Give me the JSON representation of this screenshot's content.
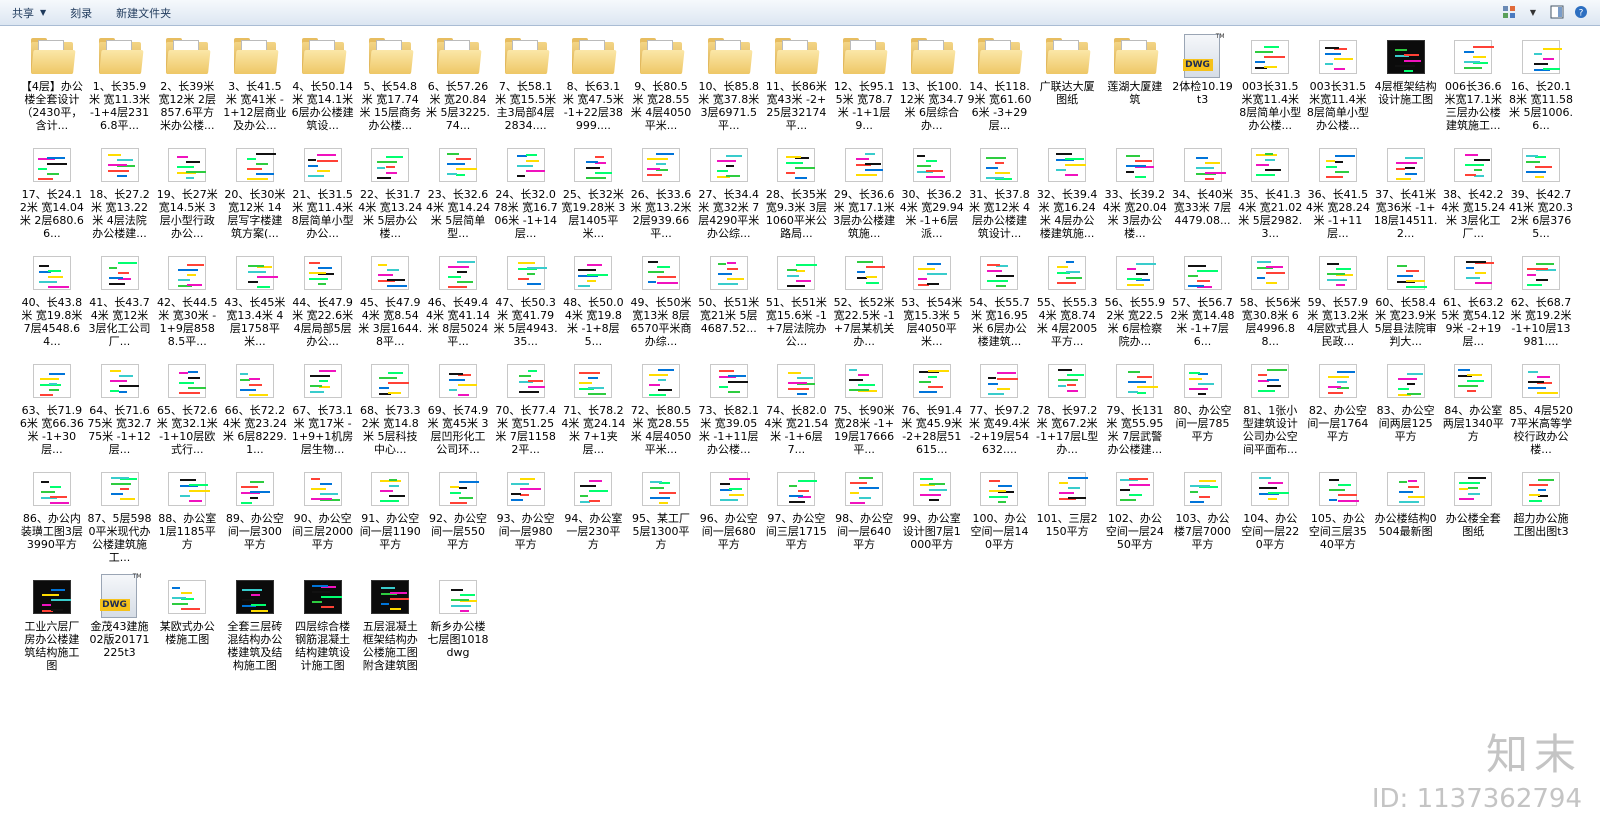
{
  "toolbar": {
    "share": "共享",
    "burn": "刻录",
    "new_folder": "新建文件夹"
  },
  "items": [
    {
      "label": "【4层】办公楼全套设计（2430平，含计...",
      "kind": "folder"
    },
    {
      "label": "1、长35.9米 宽11.3米 -1+4层2316.8平...",
      "kind": "folder"
    },
    {
      "label": "2、长39米 宽12米 2层857.6平方米办公楼...",
      "kind": "folder"
    },
    {
      "label": "3、长41.5米 宽41米 -1+12层商业及办公...",
      "kind": "folder"
    },
    {
      "label": "4、长50.14米 宽14.1米 6层办公楼建筑设...",
      "kind": "folder"
    },
    {
      "label": "5、长54.8米 宽17.74米 15层商务办公楼...",
      "kind": "folder"
    },
    {
      "label": "6、长57.26米 宽20.84米 5层3225.74...",
      "kind": "folder"
    },
    {
      "label": "7、长58.1米 宽15.5米 主3局部4层2834....",
      "kind": "folder"
    },
    {
      "label": "8、长63.1米 宽47.5米 -1+22层38999....",
      "kind": "folder"
    },
    {
      "label": "9、长80.5米 宽28.55米 4层4050平米...",
      "kind": "folder"
    },
    {
      "label": "10、长85.8米 宽37.8米 3层6971.5平...",
      "kind": "folder"
    },
    {
      "label": "11、长86米 宽43米 -2+25层32174平...",
      "kind": "folder"
    },
    {
      "label": "12、长95.15米 宽78.7米 -1+1层9...",
      "kind": "folder"
    },
    {
      "label": "13、长100.12米 宽34.7米 6层综合办...",
      "kind": "folder"
    },
    {
      "label": "14、长118.9米 宽61.606米 -3+29层...",
      "kind": "folder"
    },
    {
      "label": "广联达大厦图纸",
      "kind": "folder"
    },
    {
      "label": "莲湖大厦建筑",
      "kind": "folder"
    },
    {
      "label": "2体检10.19t3",
      "kind": "dwg"
    },
    {
      "label": "003长31.5米宽11.4米 8层简单小型办公楼...",
      "kind": "cad"
    },
    {
      "label": "003长31.5米宽11.4米 8层简单小型办公楼...",
      "kind": "cad"
    },
    {
      "label": "4层框架结构设计施工图",
      "kind": "cad-dark"
    },
    {
      "label": "006长36.6米宽17.1米 三层办公楼建筑施工...",
      "kind": "cad"
    },
    {
      "label": "16、长20.18米 宽11.58米 5层1006.6...",
      "kind": "cad"
    },
    {
      "label": "17、长24.12米 宽14.04米 2层680.66...",
      "kind": "cad"
    },
    {
      "label": "18、长27.2米 宽13.22米 4层法院办公楼建...",
      "kind": "cad"
    },
    {
      "label": "19、长27米 宽14.5米 3层小型行政办公...",
      "kind": "cad"
    },
    {
      "label": "20、长30米 宽12米 14层写字楼建筑方案(...",
      "kind": "cad"
    },
    {
      "label": "21、长31.5米 宽11.4米 8层简单小型办公...",
      "kind": "cad"
    },
    {
      "label": "22、长31.74米 宽13.24米 5层办公楼...",
      "kind": "cad"
    },
    {
      "label": "23、长32.64米 宽14.24米 5层简单型...",
      "kind": "cad"
    },
    {
      "label": "24、长32.078米 宽16.706米 -1+14层...",
      "kind": "cad"
    },
    {
      "label": "25、长32米 宽19.28米 3层1405平米...",
      "kind": "cad"
    },
    {
      "label": "26、长33.6米 宽13.2米 2层939.66平...",
      "kind": "cad"
    },
    {
      "label": "27、长34.4米 宽32米 7层4290平米办公综...",
      "kind": "cad"
    },
    {
      "label": "28、长35米 宽9.3米 3层1060平米公路局...",
      "kind": "cad"
    },
    {
      "label": "29、长36.6米 宽17.1米 3层办公楼建筑施...",
      "kind": "cad"
    },
    {
      "label": "30、长36.24米 宽29.94米 -1+6层派...",
      "kind": "cad"
    },
    {
      "label": "31、长37.8米 宽12米 4层办公楼建筑设计...",
      "kind": "cad"
    },
    {
      "label": "32、长39.4米 宽16.24米 4层办公楼建筑施...",
      "kind": "cad"
    },
    {
      "label": "33、长39.24米 宽20.04米 3层办公楼...",
      "kind": "cad"
    },
    {
      "label": "34、长40米 宽33米 7层4479.08...",
      "kind": "cad"
    },
    {
      "label": "35、长41.34米 宽21.02米 5层2982.3...",
      "kind": "cad"
    },
    {
      "label": "36、长41.54米 宽28.24米 -1+11层...",
      "kind": "cad"
    },
    {
      "label": "37、长41米 宽36米 -1+18层14511.2...",
      "kind": "cad"
    },
    {
      "label": "38、长42.24米 宽15.24米 3层化工厂...",
      "kind": "cad"
    },
    {
      "label": "39、长42.741米 宽20.32米 6层3765...",
      "kind": "cad"
    },
    {
      "label": "40、长43.8米 宽19.8米 7层4548.64...",
      "kind": "cad"
    },
    {
      "label": "41、长43.74米 宽12米 3层化工公司厂...",
      "kind": "cad"
    },
    {
      "label": "42、长44.5米 宽30米 -1+9层8588.5平...",
      "kind": "cad"
    },
    {
      "label": "43、长45米 宽13.4米 4层1758平米...",
      "kind": "cad"
    },
    {
      "label": "44、长47.9米 宽22.6米 4层局部5层办公...",
      "kind": "cad"
    },
    {
      "label": "45、长47.94米 宽8.54米 3层1644.8平...",
      "kind": "cad"
    },
    {
      "label": "46、长49.44米 宽41.14米 8层5024平...",
      "kind": "cad"
    },
    {
      "label": "47、长50.3米 宽41.79米 5层4943.35...",
      "kind": "cad"
    },
    {
      "label": "48、长50.04米 宽19.8米 -1+8层5...",
      "kind": "cad"
    },
    {
      "label": "49、长50米 宽13米 8层6570平米商办综...",
      "kind": "cad"
    },
    {
      "label": "50、长51米 宽21米 5层4687.52...",
      "kind": "cad"
    },
    {
      "label": "51、长51米 宽15.6米 -1+7层法院办公...",
      "kind": "cad"
    },
    {
      "label": "52、长52米 宽22.5米 -1+7层某机关办...",
      "kind": "cad"
    },
    {
      "label": "53、长54米 宽15.3米 5层4050平米...",
      "kind": "cad"
    },
    {
      "label": "54、长55.7米 宽16.95米 6层办公楼建筑...",
      "kind": "cad"
    },
    {
      "label": "55、长55.34米 宽8.74米 4层2005平方...",
      "kind": "cad"
    },
    {
      "label": "56、长55.92米 宽22.5米 6层检察院办...",
      "kind": "cad"
    },
    {
      "label": "57、长56.72米 宽14.48米 -1+7层6...",
      "kind": "cad"
    },
    {
      "label": "58、长56米 宽30.8米 6层4996.88...",
      "kind": "cad"
    },
    {
      "label": "59、长57.9米 宽13.2米 4层欧式县人民政...",
      "kind": "cad"
    },
    {
      "label": "60、长58.4米 宽23.9米 5层县法院审判大...",
      "kind": "cad"
    },
    {
      "label": "61、长63.25米 宽54.129米 -2+19层...",
      "kind": "cad"
    },
    {
      "label": "62、长68.7米 宽19.2米 -1+10层13981....",
      "kind": "cad"
    },
    {
      "label": "63、长71.96米 宽66.36米 -1+30层...",
      "kind": "cad"
    },
    {
      "label": "64、长71.675米 宽32.775米 -1+12层...",
      "kind": "cad"
    },
    {
      "label": "65、长72.6米 宽32.1米 -1+10层欧式行...",
      "kind": "cad"
    },
    {
      "label": "66、长72.24米 宽23.24米 6层8229.1...",
      "kind": "cad"
    },
    {
      "label": "67、长73.1米 宽17米 -1+9+1机房层生物...",
      "kind": "cad"
    },
    {
      "label": "68、长73.32米 宽14.8米 5层科技中心...",
      "kind": "cad"
    },
    {
      "label": "69、长74.9米 宽45米 3层凹形化工公司环...",
      "kind": "cad"
    },
    {
      "label": "70、长77.4米 宽51.25米 7层11582平...",
      "kind": "cad"
    },
    {
      "label": "71、长78.24米 宽24.14米 7+1夹层...",
      "kind": "cad"
    },
    {
      "label": "72、长80.5米 宽28.55米 4层4050平米...",
      "kind": "cad"
    },
    {
      "label": "73、长82.1米 宽39.05米 -1+11层办公楼...",
      "kind": "cad"
    },
    {
      "label": "74、长82.04米 宽21.54米 -1+6层7...",
      "kind": "cad"
    },
    {
      "label": "75、长90米 宽28米 -1+19层17666平...",
      "kind": "cad"
    },
    {
      "label": "76、长91.4米 宽45.9米 -2+28层51615...",
      "kind": "cad"
    },
    {
      "label": "77、长97.2米 宽49.4米 -2+19层54632....",
      "kind": "cad"
    },
    {
      "label": "78、长97.2米 宽67.2米 -1+17层L型办...",
      "kind": "cad"
    },
    {
      "label": "79、长131米 宽55.95米 7层武警办公楼建...",
      "kind": "cad"
    },
    {
      "label": "80、办公空间一层785平方",
      "kind": "cad"
    },
    {
      "label": "81、1张小型建筑设计公司办公空间平面布...",
      "kind": "cad"
    },
    {
      "label": "82、办公空间一层1764平方",
      "kind": "cad"
    },
    {
      "label": "83、办公空间两层125平方",
      "kind": "cad"
    },
    {
      "label": "84、办公室两层1340平方",
      "kind": "cad"
    },
    {
      "label": "85、4层5207平米高等学校行政办公楼...",
      "kind": "cad"
    },
    {
      "label": "86、办公内装璜工图3层3990平方",
      "kind": "cad"
    },
    {
      "label": "87、5层5980平米现代办公楼建筑施工...",
      "kind": "cad"
    },
    {
      "label": "88、办公室1层1185平方",
      "kind": "cad"
    },
    {
      "label": "89、办公空间一层300平方",
      "kind": "cad"
    },
    {
      "label": "90、办公空间三层2000平方",
      "kind": "cad"
    },
    {
      "label": "91、办公空间一层1190平方",
      "kind": "cad"
    },
    {
      "label": "92、办公空间一层550平方",
      "kind": "cad"
    },
    {
      "label": "93、办公空间一层980平方",
      "kind": "cad"
    },
    {
      "label": "94、办公室一层230平方",
      "kind": "cad"
    },
    {
      "label": "95、某工厂5层1300平方",
      "kind": "cad"
    },
    {
      "label": "96、办公空间一层680平方",
      "kind": "cad"
    },
    {
      "label": "97、办公空间三层1715平方",
      "kind": "cad"
    },
    {
      "label": "98、办公空间一层640平方",
      "kind": "cad"
    },
    {
      "label": "99、办公室设计图7层1000平方",
      "kind": "cad"
    },
    {
      "label": "100、办公空间一层140平方",
      "kind": "cad"
    },
    {
      "label": "101、三层2150平方",
      "kind": "cad"
    },
    {
      "label": "102、办公空间一层2450平方",
      "kind": "cad"
    },
    {
      "label": "103、办公楼7层7000平方",
      "kind": "cad"
    },
    {
      "label": "104、办公空间一层220平方",
      "kind": "cad"
    },
    {
      "label": "105、办公空间三层3540平方",
      "kind": "cad"
    },
    {
      "label": "办公楼结构0504最新图",
      "kind": "cad"
    },
    {
      "label": "办公楼全套图纸",
      "kind": "cad"
    },
    {
      "label": "超力办公施工图出图t3",
      "kind": "cad"
    },
    {
      "label": "工业六层厂房办公楼建筑结构施工图",
      "kind": "cad-dark"
    },
    {
      "label": "金茂43建施02版20171225t3",
      "kind": "dwg"
    },
    {
      "label": "某欧式办公楼施工图",
      "kind": "cad"
    },
    {
      "label": "全套三层砖混结构办公楼建筑及结构施工图",
      "kind": "cad-dark"
    },
    {
      "label": "四层综合楼钢筋混凝土结构建筑设计施工图",
      "kind": "cad-dark"
    },
    {
      "label": "五层混凝土框架结构办公楼施工图附含建筑图",
      "kind": "cad-dark"
    },
    {
      "label": "新乡办公楼七层图1018dwg",
      "kind": "cad"
    }
  ],
  "watermark": {
    "brand": "知末",
    "id": "ID: 1137362794"
  }
}
